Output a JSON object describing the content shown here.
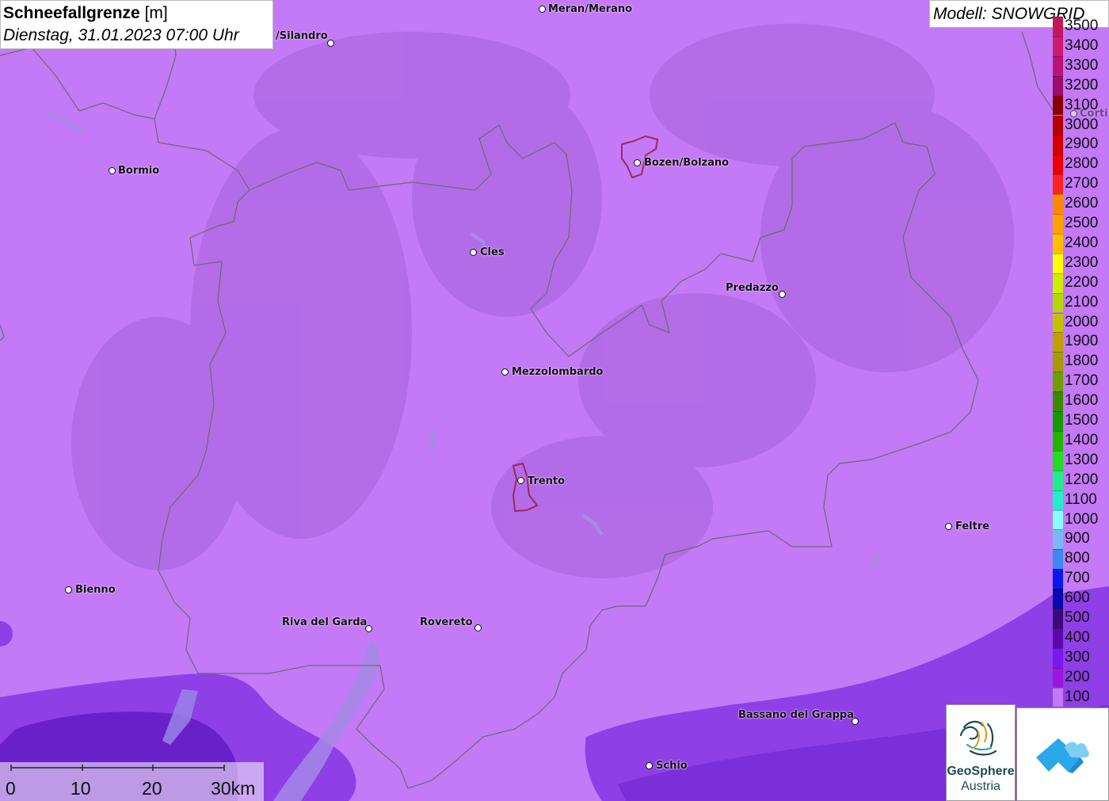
{
  "title": {
    "parameter": "Schneefallgrenze",
    "unit": "[m]",
    "datetime": "Dienstag, 31.01.2023 07:00 Uhr"
  },
  "model": "Modell: SNOWGRID",
  "legend": {
    "entries": [
      {
        "label": "3500",
        "color": "#c2185b"
      },
      {
        "label": "3400",
        "color": "#cc1c72"
      },
      {
        "label": "3300",
        "color": "#b81478"
      },
      {
        "label": "3200",
        "color": "#9c0c6b"
      },
      {
        "label": "3100",
        "color": "#8a0000"
      },
      {
        "label": "3000",
        "color": "#b50000"
      },
      {
        "label": "2900",
        "color": "#d40000"
      },
      {
        "label": "2800",
        "color": "#ee0000"
      },
      {
        "label": "2700",
        "color": "#ff2222"
      },
      {
        "label": "2600",
        "color": "#ff8a00"
      },
      {
        "label": "2500",
        "color": "#ffa000"
      },
      {
        "label": "2400",
        "color": "#ffbe00"
      },
      {
        "label": "2300",
        "color": "#ffff00"
      },
      {
        "label": "2200",
        "color": "#ccee00"
      },
      {
        "label": "2100",
        "color": "#b4d800"
      },
      {
        "label": "2000",
        "color": "#c2c200"
      },
      {
        "label": "1900",
        "color": "#bfa000"
      },
      {
        "label": "1800",
        "color": "#a69a00"
      },
      {
        "label": "1700",
        "color": "#6ca000"
      },
      {
        "label": "1600",
        "color": "#3a8a00"
      },
      {
        "label": "1500",
        "color": "#129a00"
      },
      {
        "label": "1400",
        "color": "#22b400"
      },
      {
        "label": "1300",
        "color": "#22dd22"
      },
      {
        "label": "1200",
        "color": "#22ee88"
      },
      {
        "label": "1100",
        "color": "#22eecc"
      },
      {
        "label": "1000",
        "color": "#88ffff"
      },
      {
        "label": "900",
        "color": "#7ab8f5"
      },
      {
        "label": "800",
        "color": "#3a8aee"
      },
      {
        "label": "700",
        "color": "#0a18ee"
      },
      {
        "label": "600",
        "color": "#0a0aa8"
      },
      {
        "label": "500",
        "color": "#3a0a7a"
      },
      {
        "label": "400",
        "color": "#5a0aaa"
      },
      {
        "label": "300",
        "color": "#7a18ee"
      },
      {
        "label": "200",
        "color": "#9a18dd"
      },
      {
        "label": "100",
        "color": "#c477f7"
      }
    ]
  },
  "cities": [
    {
      "name": "Meran/Merano",
      "side": "right"
    },
    {
      "name": "/Silandro",
      "side": "left"
    },
    {
      "name": "Bormio",
      "side": "right"
    },
    {
      "name": "Bozen/Bolzano",
      "side": "right"
    },
    {
      "name": "Cles",
      "side": "right"
    },
    {
      "name": "Predazzo",
      "side": "left"
    },
    {
      "name": "Mezzolombardo",
      "side": "right"
    },
    {
      "name": "Trento",
      "side": "right"
    },
    {
      "name": "Feltre",
      "side": "right"
    },
    {
      "name": "Bienno",
      "side": "right"
    },
    {
      "name": "Riva del Garda",
      "side": "left"
    },
    {
      "name": "Rovereto",
      "side": "left"
    },
    {
      "name": "Bassano del Grappa",
      "side": "left"
    },
    {
      "name": "Schio",
      "side": "right"
    },
    {
      "name": "Corti",
      "side": "right"
    }
  ],
  "scalebar": {
    "labels": [
      "0",
      "10",
      "20",
      "30km"
    ]
  },
  "logos": {
    "geosphere_name": "GeoSphere",
    "geosphere_sub": "Austria"
  },
  "colors": {
    "base_fill": "#c479f7",
    "low_fill": "#8e3fe6",
    "lowest_fill": "#6a20c8",
    "border_line": "#6b6b6b",
    "city_outline": "#9b2a5a"
  }
}
